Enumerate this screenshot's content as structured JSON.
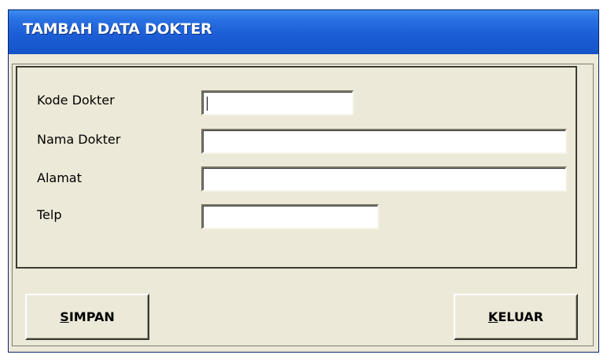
{
  "window": {
    "title": "TAMBAH DATA DOKTER"
  },
  "form": {
    "fields": [
      {
        "label": "Kode Dokter",
        "value": ""
      },
      {
        "label": "Nama Dokter",
        "value": ""
      },
      {
        "label": "Alamat",
        "value": ""
      },
      {
        "label": "Telp",
        "value": ""
      }
    ]
  },
  "buttons": {
    "save": {
      "accel": "S",
      "rest": "IMPAN"
    },
    "exit": {
      "accel": "K",
      "rest": "ELUAR"
    }
  }
}
